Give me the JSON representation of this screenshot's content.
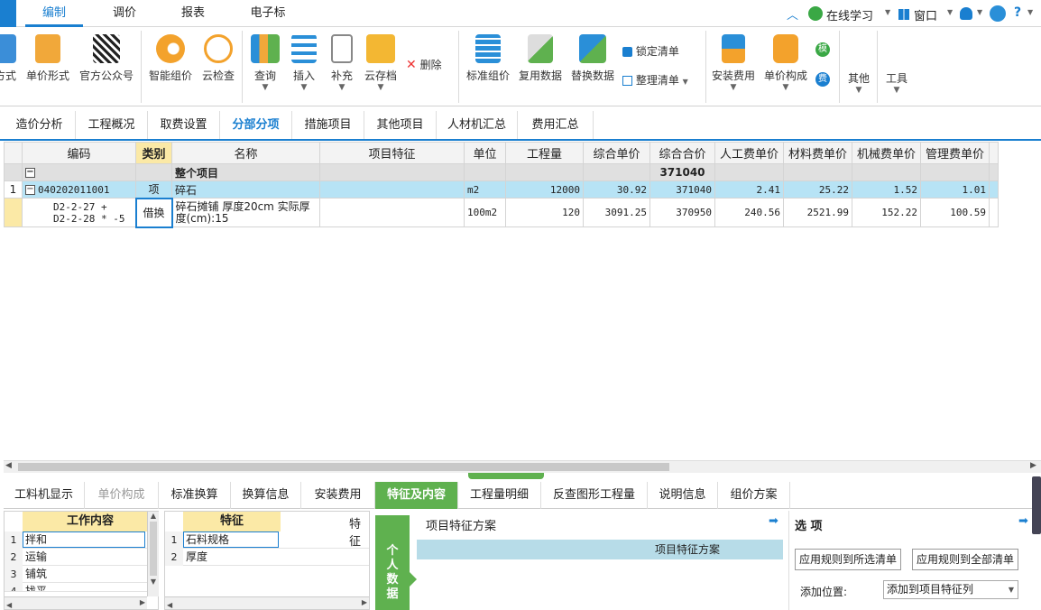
{
  "menu": {
    "tabs": [
      "编制",
      "调价",
      "报表",
      "电子标"
    ],
    "active": "编制",
    "online_learning": "在线学习",
    "window": "窗口"
  },
  "ribbon": {
    "fangshi": "方式",
    "unit_price_form": "单价形式",
    "official_account": "官方公众号",
    "smart_pricing": "智能组价",
    "cloud_check": "云检查",
    "query": "查询",
    "insert": "插入",
    "supplement": "补充",
    "cloud_archive": "云存档",
    "delete": "删除",
    "standard_pricing": "标准组价",
    "reuse_data": "复用数据",
    "replace_data": "替换数据",
    "lock_list": "锁定清单",
    "organize_list": "整理清单",
    "install_cost": "安装费用",
    "unit_price_composition": "单价构成",
    "mo_badge": "模",
    "fei_badge": "费",
    "other": "其他",
    "tools": "工具"
  },
  "main_tabs": [
    "造价分析",
    "工程概况",
    "取费设置",
    "分部分项",
    "措施项目",
    "其他项目",
    "人材机汇总",
    "费用汇总"
  ],
  "main_tab_active": "分部分项",
  "grid": {
    "headers": [
      "编码",
      "类别",
      "名称",
      "项目特征",
      "单位",
      "工程量",
      "综合单价",
      "综合合价",
      "人工费单价",
      "材料费单价",
      "机械费单价",
      "管理费单价"
    ],
    "total_row": {
      "name": "整个项目",
      "total": "371040"
    },
    "item_row": {
      "index": "1",
      "code": "040202011001",
      "category": "项",
      "name": "碎石",
      "unit": "m2",
      "qty": "12000",
      "unit_price": "30.92",
      "total": "371040",
      "labor": "2.41",
      "material": "25.22",
      "machine": "1.52",
      "mgmt": "1.01"
    },
    "sub_row": {
      "code_line1": "D2-2-27 +",
      "code_line2": "D2-2-28 * -5",
      "category": "借换",
      "name_line1": "碎石摊铺 厚度20cm  实际厚",
      "name_line2": "度(cm):15",
      "unit": "100m2",
      "qty": "120",
      "unit_price": "3091.25",
      "total": "370950",
      "labor": "240.56",
      "material": "2521.99",
      "machine": "152.22",
      "mgmt": "100.59"
    }
  },
  "bottom_tabs": [
    "工料机显示",
    "单价构成",
    "标准换算",
    "换算信息",
    "安装费用",
    "特征及内容",
    "工程量明细",
    "反查图形工程量",
    "说明信息",
    "组价方案"
  ],
  "bottom_tab_active": "特征及内容",
  "work_content": {
    "header": "工作内容",
    "items": [
      {
        "n": "1",
        "text": "拌和"
      },
      {
        "n": "2",
        "text": "运输"
      },
      {
        "n": "3",
        "text": "铺筑"
      },
      {
        "n": "4",
        "text": "找平"
      }
    ]
  },
  "features": {
    "header": "特征",
    "header2": "特征",
    "items": [
      {
        "n": "1",
        "text": "石料规格"
      },
      {
        "n": "2",
        "text": "厚度"
      }
    ]
  },
  "personal_data": "个人数据",
  "scheme": {
    "title": "项目特征方案",
    "row": "项目特征方案"
  },
  "options": {
    "title": "选 项",
    "apply_selected": "应用规则到所选清单",
    "apply_all": "应用规则到全部清单",
    "add_position_label": "添加位置:",
    "add_position_value": "添加到项目特征列"
  }
}
